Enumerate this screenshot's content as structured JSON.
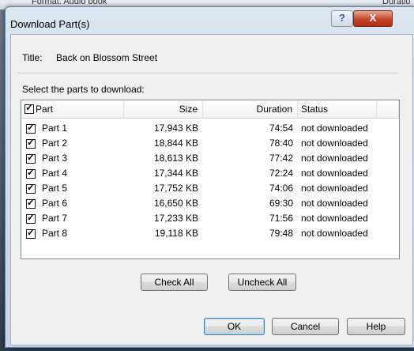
{
  "background": {
    "left_text": "Format: Audio book",
    "right_text": "Duratio"
  },
  "window": {
    "title": "Download Part(s)",
    "help_glyph": "?",
    "close_glyph": "X"
  },
  "book": {
    "title_label": "Title:",
    "title_value": "Back on Blossom Street"
  },
  "select_label": "Select the parts to download:",
  "columns": {
    "part": "Part",
    "size": "Size",
    "duration": "Duration",
    "status": "Status"
  },
  "header_checked": true,
  "parts": [
    {
      "name": "Part 1",
      "size": "17,943 KB",
      "duration": "74:54",
      "status": "not downloaded",
      "checked": true
    },
    {
      "name": "Part 2",
      "size": "18,844 KB",
      "duration": "78:40",
      "status": "not downloaded",
      "checked": true
    },
    {
      "name": "Part 3",
      "size": "18,613 KB",
      "duration": "77:42",
      "status": "not downloaded",
      "checked": true
    },
    {
      "name": "Part 4",
      "size": "17,344 KB",
      "duration": "72:24",
      "status": "not downloaded",
      "checked": true
    },
    {
      "name": "Part 5",
      "size": "17,752 KB",
      "duration": "74:06",
      "status": "not downloaded",
      "checked": true
    },
    {
      "name": "Part 6",
      "size": "16,650 KB",
      "duration": "69:30",
      "status": "not downloaded",
      "checked": true
    },
    {
      "name": "Part 7",
      "size": "17,233 KB",
      "duration": "71:56",
      "status": "not downloaded",
      "checked": true
    },
    {
      "name": "Part 8",
      "size": "19,118 KB",
      "duration": "79:48",
      "status": "not downloaded",
      "checked": true
    }
  ],
  "buttons": {
    "check_all": "Check All",
    "uncheck_all": "Uncheck All",
    "ok": "OK",
    "cancel": "Cancel",
    "help": "Help"
  },
  "colors": {
    "close_button": "#c5462b",
    "title_bar": "#dbe6f2",
    "default_button_border": "#3c7fb1"
  }
}
